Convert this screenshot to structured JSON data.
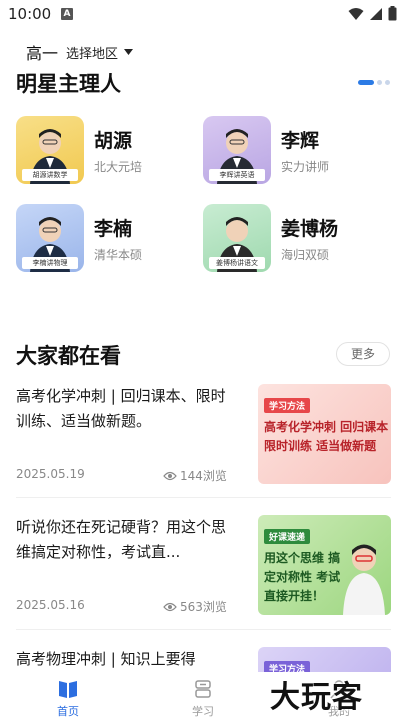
{
  "status": {
    "time": "10:00",
    "indicator": "A"
  },
  "header": {
    "grade": "高一",
    "region": "选择地区"
  },
  "teachers_section": {
    "title": "明星主理人",
    "teachers": [
      {
        "name": "胡源",
        "desc": "北大元培",
        "caption": "胡源讲数学"
      },
      {
        "name": "李辉",
        "desc": "实力讲师",
        "caption": "李辉讲英语"
      },
      {
        "name": "李楠",
        "desc": "清华本硕",
        "caption": "李楠讲物理"
      },
      {
        "name": "姜博杨",
        "desc": "海归双硕",
        "caption": "姜博杨讲语文"
      }
    ]
  },
  "popular_section": {
    "title": "大家都在看",
    "more": "更多",
    "articles": [
      {
        "title": "高考化学冲刺 | 回归课本、限时训练、适当做新题。",
        "date": "2025.05.19",
        "views": "144浏览",
        "thumb_tag": "学习方法",
        "thumb_text": "高考化学冲刺 回归课本限时训练 适当做新题"
      },
      {
        "title": "听说你还在死记硬背？用这个思维搞定对称性，考试直...",
        "date": "2025.05.16",
        "views": "563浏览",
        "thumb_tag": "好课速递",
        "thumb_text": "用这个思维 搞定对称性 考试直接开挂！"
      },
      {
        "title": "高考物理冲刺 | 知识上要得",
        "thumb_tag": "学习方法"
      }
    ]
  },
  "tabbar": {
    "home": "首页",
    "study": "学习",
    "me": "我的"
  },
  "watermark": "大玩客",
  "colors": {
    "accent": "#2c6ee0"
  }
}
